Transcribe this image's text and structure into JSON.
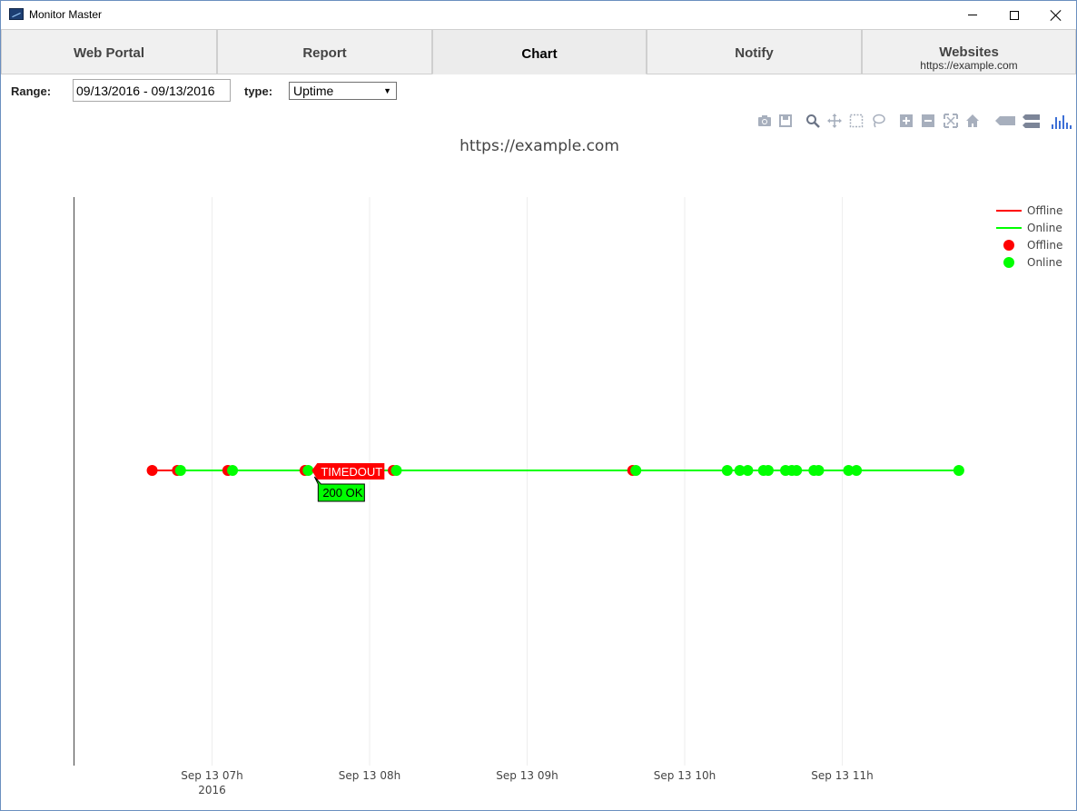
{
  "app": {
    "title": "Monitor Master",
    "icon": "app-monitor-icon"
  },
  "window_controls": {
    "minimize_icon": "minimize-icon",
    "maximize_icon": "maximize-icon",
    "close_icon": "close-icon"
  },
  "tabs": [
    {
      "label": "Web Portal",
      "active": false
    },
    {
      "label": "Report",
      "active": false
    },
    {
      "label": "Chart",
      "active": true
    },
    {
      "label": "Notify",
      "active": false
    },
    {
      "label": "Websites",
      "sublabel": "https://example.com",
      "active": false
    }
  ],
  "controls": {
    "range_label": "Range:",
    "range_value": "09/13/2016 - 09/13/2016",
    "type_label": "type:",
    "type_value": "Uptime"
  },
  "modebar": [
    "camera-icon",
    "save-icon",
    "zoom-icon",
    "pan-icon",
    "box-select-icon",
    "lasso-select-icon",
    "zoom-in-icon",
    "zoom-out-icon",
    "autoscale-icon",
    "reset-axes-icon",
    "hover-closest-icon",
    "hover-compare-icon",
    "plotly-logo-icon"
  ],
  "colors": {
    "offline": "#ff0000",
    "online": "#00ff00",
    "grid": "#eeeeee",
    "axis": "#444444"
  },
  "chart_data": {
    "type": "scatter",
    "title": "https://example.com",
    "x_axis": {
      "type": "date",
      "tick_labels": [
        "Sep 13 07h",
        "Sep 13 08h",
        "Sep 13 09h",
        "Sep 13 10h",
        "Sep 13 11h"
      ],
      "tick_hours": [
        7,
        8,
        9,
        10,
        11
      ],
      "year_label": "2016",
      "range_hours": [
        6.12,
        12.0
      ]
    },
    "y_axis": {
      "visible": false
    },
    "legend": {
      "placement": "top-right",
      "entries": [
        {
          "name": "Offline",
          "kind": "line",
          "color": "#ff0000"
        },
        {
          "name": "Online",
          "kind": "line",
          "color": "#00ff00"
        },
        {
          "name": "Offline",
          "kind": "marker",
          "color": "#ff0000"
        },
        {
          "name": "Online",
          "kind": "marker",
          "color": "#00ff00"
        }
      ]
    },
    "series": [
      {
        "name": "Offline",
        "status": "offline",
        "x_hours": [
          6.62,
          6.78,
          7.1,
          7.59,
          8.15,
          9.67
        ]
      },
      {
        "name": "Online",
        "status": "online",
        "x_hours": [
          6.8,
          7.13,
          7.61,
          8.17,
          9.69,
          10.27,
          10.35,
          10.4,
          10.5,
          10.53,
          10.64,
          10.68,
          10.71,
          10.82,
          10.85,
          11.04,
          11.09,
          11.74
        ]
      }
    ],
    "hover_labels": [
      {
        "text": "TIMEDOUT",
        "color": "#ff0000",
        "at_hours": 7.61
      },
      {
        "text": "200 OK",
        "color": "#00ff00",
        "at_hours": 7.61
      }
    ]
  }
}
